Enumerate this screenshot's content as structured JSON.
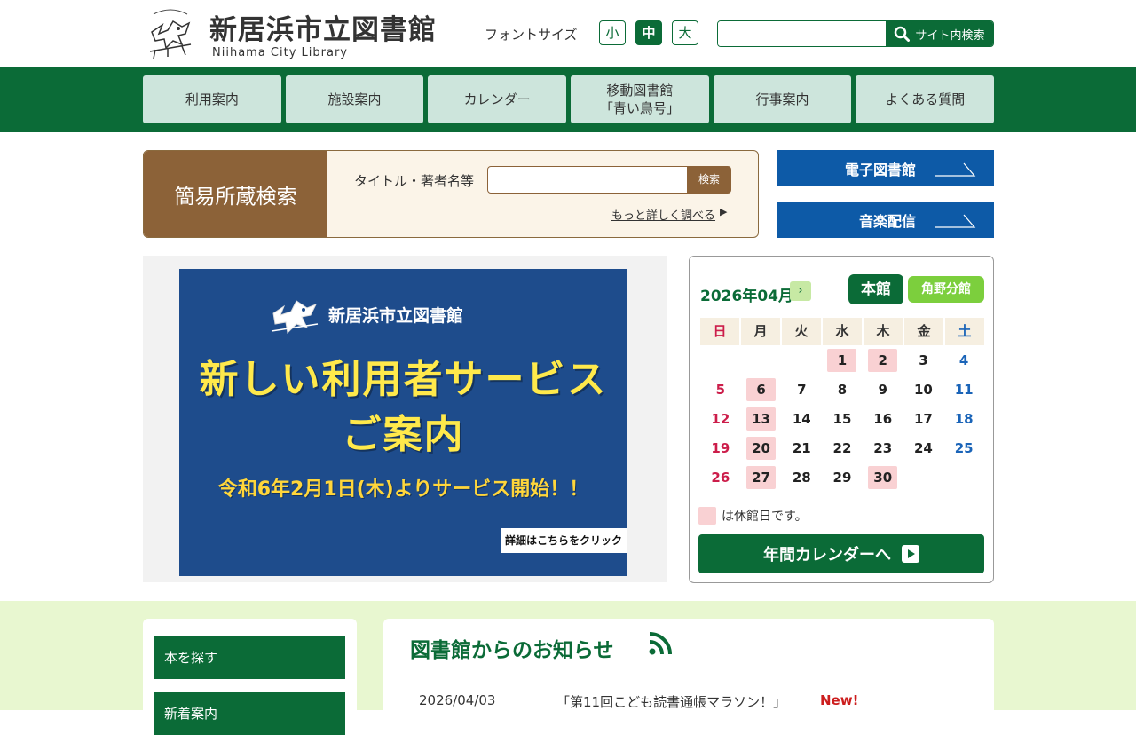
{
  "header": {
    "title": "新居浜市立図書館",
    "subtitle": "Niihama City Library",
    "font_size_label": "フォントサイズ",
    "font_sizes": [
      "小",
      "中",
      "大"
    ],
    "site_search_button": "サイト内検索"
  },
  "nav": {
    "items": [
      "利用案内",
      "施設案内",
      "カレンダー",
      "移動図書館\n「青い鳥号」",
      "行事案内",
      "よくある質問"
    ]
  },
  "catalog_search": {
    "label": "簡易所蔵検索",
    "field_label": "タイトル・著者名等",
    "button": "検索",
    "more_link": "もっと詳しく調べる"
  },
  "quick_links": {
    "ebook": "電子図書館",
    "music": "音楽配信"
  },
  "banner": {
    "library_name": "新居浜市立図書館",
    "title_line1": "新しい利用者サービス",
    "title_line2": "ご案内",
    "date_line": "令和6年2月1日(木)よりサービス開始！！",
    "detail": "詳細はこちらをクリック"
  },
  "calendar": {
    "month": "2026年04月",
    "next": "›",
    "tab_main": "本館",
    "tab_branch": "角野分館",
    "weekdays": [
      "日",
      "月",
      "火",
      "水",
      "木",
      "金",
      "土"
    ],
    "weeks": [
      [
        "",
        "",
        "",
        "1",
        "2",
        "3",
        "4"
      ],
      [
        "5",
        "6",
        "7",
        "8",
        "9",
        "10",
        "11"
      ],
      [
        "12",
        "13",
        "14",
        "15",
        "16",
        "17",
        "18"
      ],
      [
        "19",
        "20",
        "21",
        "22",
        "23",
        "24",
        "25"
      ],
      [
        "26",
        "27",
        "28",
        "29",
        "30",
        "",
        ""
      ]
    ],
    "closed_days": [
      "1",
      "2",
      "6",
      "13",
      "20",
      "27",
      "30"
    ],
    "legend": "は休館日です。",
    "annual_link": "年間カレンダーへ"
  },
  "sidebar": {
    "links": [
      "本を探す",
      "新着案内"
    ]
  },
  "news": {
    "title": "図書館からのお知らせ",
    "items": [
      {
        "date": "2026/04/03",
        "text": "「第11回こども読書通帳マラソン！」",
        "badge": "New!"
      }
    ]
  },
  "colors": {
    "brand_green": "#0b6b37",
    "nav_item_bg": "#cde5dc",
    "catalog_brown": "#8c6238",
    "link_blue": "#0d5aa7",
    "closed_pink": "#f9d1d3",
    "bottom_bg": "#e8f7d0"
  }
}
